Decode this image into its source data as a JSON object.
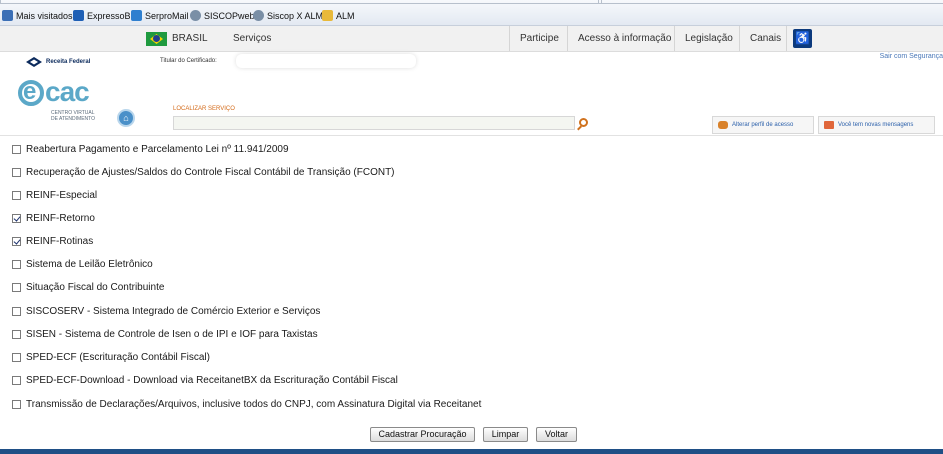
{
  "browser": {
    "bookmarks": [
      {
        "label": "Mais visitados",
        "icon": "bookmark-star-icon",
        "color": "#3b6fb6"
      },
      {
        "label": "ExpressoBr",
        "icon": "expresso-icon",
        "color": "#1e5fb5"
      },
      {
        "label": "SerproMail",
        "icon": "serpromail-icon",
        "color": "#2f7fcf"
      },
      {
        "label": "SISCOPweb",
        "icon": "globe-icon",
        "color": "#7a8fa6"
      },
      {
        "label": "Siscop X ALM",
        "icon": "globe-icon",
        "color": "#7a8fa6"
      },
      {
        "label": "ALM",
        "icon": "folder-icon",
        "color": "#e8b93a"
      }
    ]
  },
  "gov_bar": {
    "country": "BRASIL",
    "services": "Serviços",
    "links": [
      "Participe",
      "Acesso à informação",
      "Legislação",
      "Canais"
    ],
    "accessibility_icon": "accessibility-icon"
  },
  "header": {
    "logo_text": "Receita Federal",
    "titular_label": "Titular do Certificado:",
    "logout": "Sair com Segurança",
    "ecac_e": "e",
    "ecac_cac": "cac",
    "ecac_sub1": "CENTRO VIRTUAL",
    "ecac_sub2": "DE ATENDIMENTO",
    "search_label": "LOCALIZAR SERVIÇO",
    "search_value": "",
    "profile_button": "Alterar perfil de acesso",
    "messages_button": "Você tem novas mensagens"
  },
  "services": [
    {
      "label": "Reabertura Pagamento e Parcelamento Lei nº 11.941/2009",
      "checked": false
    },
    {
      "label": "Recuperação de Ajustes/Saldos do Controle Fiscal Contábil de Transição (FCONT)",
      "checked": false
    },
    {
      "label": "REINF-Especial",
      "checked": false
    },
    {
      "label": "REINF-Retorno",
      "checked": true
    },
    {
      "label": "REINF-Rotinas",
      "checked": true
    },
    {
      "label": "Sistema de Leilão Eletrônico",
      "checked": false
    },
    {
      "label": "Situação Fiscal do Contribuinte",
      "checked": false
    },
    {
      "label": "SISCOSERV - Sistema Integrado de Comércio Exterior e Serviços",
      "checked": false
    },
    {
      "label": "SISEN - Sistema de Controle de Isen o de IPI e IOF para Taxistas",
      "checked": false
    },
    {
      "label": "SPED-ECF (Escrituração Contábil Fiscal)",
      "checked": false
    },
    {
      "label": "SPED-ECF-Download - Download via ReceitanetBX da Escrituração Contábil Fiscal",
      "checked": false
    },
    {
      "label": "Transmissão de Declarações/Arquivos, inclusive todos do CNPJ, com Assinatura Digital via Receitanet",
      "checked": false
    }
  ],
  "actions": {
    "register": "Cadastrar Procuração",
    "clear": "Limpar",
    "back": "Voltar"
  },
  "colors": {
    "accent_blue": "#5ba8c8",
    "link_blue": "#2a5faa",
    "search_orange": "#d46b1a",
    "gov_dark": "#1f4f86"
  }
}
